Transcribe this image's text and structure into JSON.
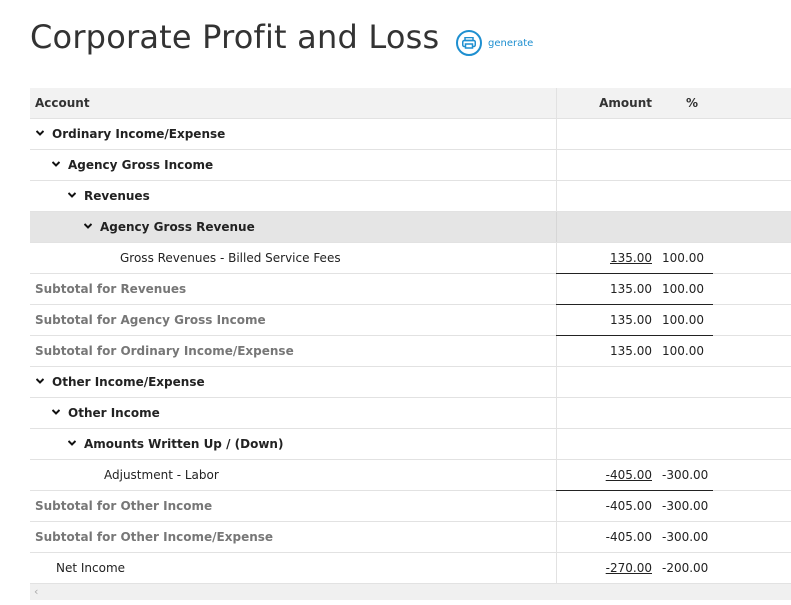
{
  "page": {
    "title": "Corporate Profit and Loss",
    "generate_label": "generate"
  },
  "table": {
    "headers": {
      "account": "Account",
      "amount": "Amount",
      "percent": "%"
    },
    "rows": [
      {
        "label": "Ordinary Income/Expense",
        "amount": "",
        "percent": ""
      },
      {
        "label": "Agency Gross Income",
        "amount": "",
        "percent": ""
      },
      {
        "label": "Revenues",
        "amount": "",
        "percent": ""
      },
      {
        "label": "Agency Gross Revenue",
        "amount": "",
        "percent": ""
      },
      {
        "label": "Gross Revenues - Billed Service Fees",
        "amount": "135.00",
        "percent": "100.00"
      },
      {
        "label": "Subtotal for Revenues",
        "amount": "135.00",
        "percent": "100.00"
      },
      {
        "label": "Subtotal for Agency Gross Income",
        "amount": "135.00",
        "percent": "100.00"
      },
      {
        "label": "Subtotal for Ordinary Income/Expense",
        "amount": "135.00",
        "percent": "100.00"
      },
      {
        "label": "Other Income/Expense",
        "amount": "",
        "percent": ""
      },
      {
        "label": "Other Income",
        "amount": "",
        "percent": ""
      },
      {
        "label": "Amounts Written Up / (Down)",
        "amount": "",
        "percent": ""
      },
      {
        "label": "Adjustment - Labor",
        "amount": "-405.00",
        "percent": "-300.00"
      },
      {
        "label": "Subtotal for Other Income",
        "amount": "-405.00",
        "percent": "-300.00"
      },
      {
        "label": "Subtotal for Other Income/Expense",
        "amount": "-405.00",
        "percent": "-300.00"
      },
      {
        "label": "Net Income",
        "amount": "-270.00",
        "percent": "-200.00"
      }
    ]
  },
  "colors": {
    "accent": "#1e8fd0",
    "subtotal_text": "#777777",
    "header_bg": "#f2f2f2",
    "shaded_row_bg": "#e5e5e5"
  },
  "icons": {
    "generate": "printer-icon",
    "expand": "chevron-down-icon",
    "scroll_left": "arrow-left-icon"
  }
}
